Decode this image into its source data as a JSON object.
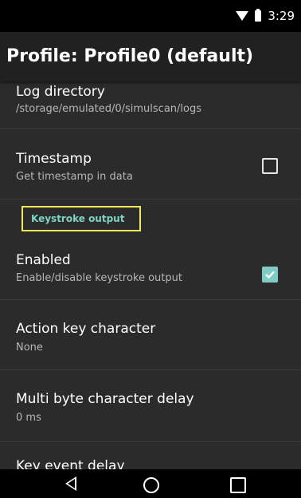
{
  "status_bar": {
    "time": "3:29"
  },
  "app_bar": {
    "title": "Profile: Profile0 (default)"
  },
  "preferences": {
    "log_directory": {
      "title": "Log directory",
      "summary": "/storage/emulated/0/simulscan/logs"
    },
    "timestamp": {
      "title": "Timestamp",
      "summary": "Get timestamp in data",
      "checked": false
    },
    "category_keystroke": {
      "label": "Keystroke output",
      "highlight_color": "#f1e85c",
      "text_color": "#7fd3c4"
    },
    "enabled": {
      "title": "Enabled",
      "summary": "Enable/disable keystroke output",
      "checked": true
    },
    "action_key": {
      "title": "Action key character",
      "summary": "None"
    },
    "multibyte_delay": {
      "title": "Multi byte character delay",
      "summary": "0 ms"
    },
    "key_event_delay": {
      "title": "Key event delay"
    }
  },
  "nav_bar": {
    "icons": [
      "back-icon",
      "home-icon",
      "recents-icon"
    ]
  }
}
